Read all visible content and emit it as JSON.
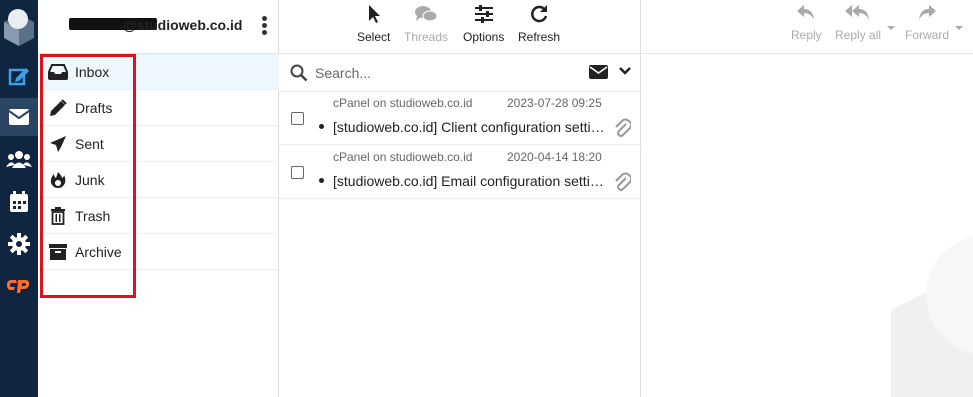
{
  "app": {
    "account_email": "@studioweb.co.id"
  },
  "rail": {
    "items": [
      {
        "icon": "compose-icon"
      },
      {
        "icon": "mail-icon",
        "active": true
      },
      {
        "icon": "contacts-icon"
      },
      {
        "icon": "calendar-icon"
      },
      {
        "icon": "settings-icon"
      },
      {
        "icon": "cpanel-icon"
      }
    ]
  },
  "folders": [
    {
      "label": "Inbox",
      "icon": "inbox-icon",
      "selected": true
    },
    {
      "label": "Drafts",
      "icon": "pencil-icon"
    },
    {
      "label": "Sent",
      "icon": "paper-plane-icon"
    },
    {
      "label": "Junk",
      "icon": "fire-icon"
    },
    {
      "label": "Trash",
      "icon": "trash-icon"
    },
    {
      "label": "Archive",
      "icon": "archive-icon"
    }
  ],
  "toolbar": {
    "select_label": "Select",
    "threads_label": "Threads",
    "options_label": "Options",
    "refresh_label": "Refresh"
  },
  "search": {
    "placeholder": "Search..."
  },
  "messages": [
    {
      "from": "cPanel on studioweb.co.id",
      "date": "2023-07-28 09:25",
      "subject": "[studioweb.co.id] Client configuration settings",
      "unread": true,
      "has_attachment": true
    },
    {
      "from": "cPanel on studioweb.co.id",
      "date": "2020-04-14 18:20",
      "subject": "[studioweb.co.id] Email configuration settings",
      "unread": true,
      "has_attachment": true
    }
  ],
  "preview_toolbar": {
    "reply_label": "Reply",
    "reply_all_label": "Reply all",
    "forward_label": "Forward"
  },
  "colors": {
    "rail_bg": "#0f2540",
    "rail_icon": "#3aa0e8",
    "cpanel_orange": "#ff6c2c",
    "highlight_red": "#d9141c",
    "selected_folder_bg": "#eef7fd"
  }
}
